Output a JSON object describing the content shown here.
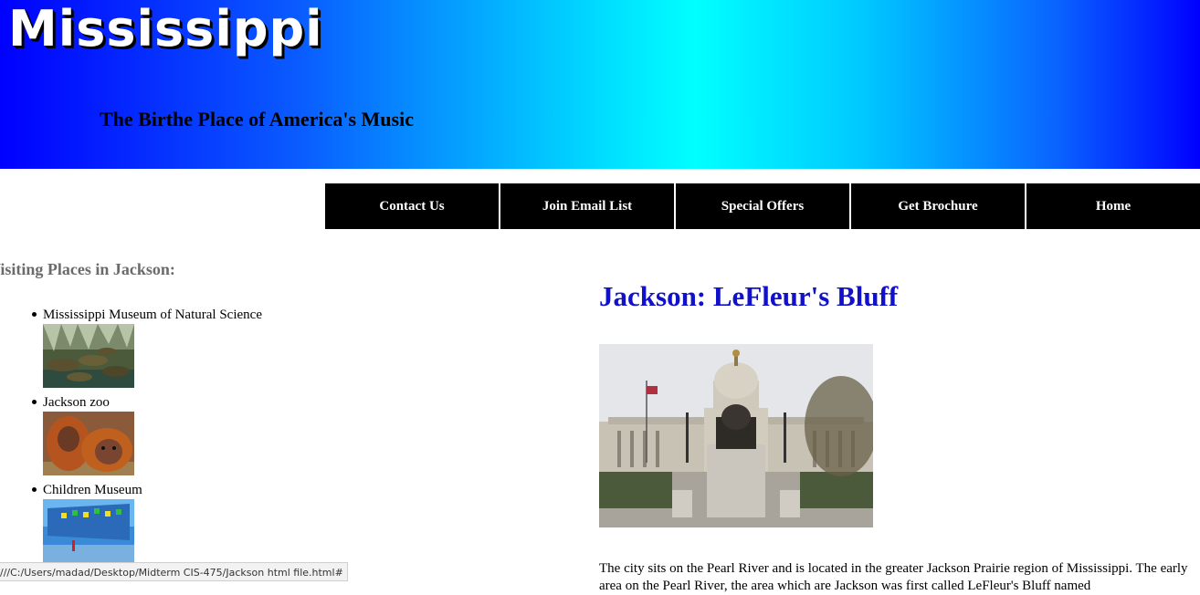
{
  "banner": {
    "title": "Mississippi",
    "tagline": "The Birthe Place of America's Music"
  },
  "nav": {
    "items": [
      "Contact Us",
      "Join Email List",
      "Special Offers",
      "Get Brochure",
      "Home"
    ]
  },
  "sidebar": {
    "heading": "Visiting Places in Jackson:",
    "places": [
      {
        "label": "Mississippi Museum of Natural Science",
        "image": "turtles-photo"
      },
      {
        "label": "Jackson zoo",
        "image": "orangutan-photo"
      },
      {
        "label": "Children Museum",
        "image": "children-museum-photo"
      }
    ]
  },
  "article": {
    "title": "Jackson: LeFleur's Bluff",
    "image": "capitol-building-photo",
    "text": "The city sits on the Pearl River and is located in the greater Jackson Prairie region of Mississippi. The early area on the Pearl River, the area which are Jackson was first called LeFleur's Bluff named"
  },
  "status": {
    "url": "///C:/Users/madad/Desktop/Midterm CIS-475/Jackson html file.html#"
  }
}
